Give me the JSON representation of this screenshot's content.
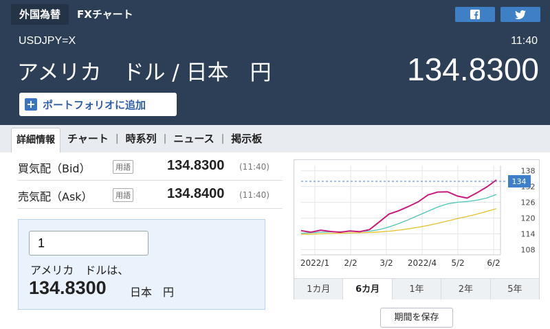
{
  "nav": {
    "tabs": [
      {
        "label": "外国為替"
      },
      {
        "label": "FXチャート"
      }
    ],
    "social": [
      "facebook-icon",
      "twitter-icon"
    ]
  },
  "quote": {
    "symbol": "USDJPY=X",
    "time": "11:40",
    "pair_name": "アメリカ　ドル / 日本　円",
    "price": "134.8300",
    "portfolio_button": "ポートフォリオに追加"
  },
  "subtabs": [
    "詳細情報",
    "チャート",
    "時系列",
    "ニュース",
    "掲示板"
  ],
  "separator": "|",
  "rows": [
    {
      "label": "買気配（Bid）",
      "tag": "用語",
      "value": "134.8300",
      "time": "(11:40)"
    },
    {
      "label": "売気配（Ask）",
      "tag": "用語",
      "value": "134.8400",
      "time": "(11:40)"
    }
  ],
  "converter": {
    "input_value": "1",
    "from_text": "アメリカ　ドルは、",
    "result": "134.8300",
    "to_currency": "日本　円"
  },
  "chart_data": {
    "type": "line",
    "x_labels": [
      "2022/1",
      "2/2",
      "3/2",
      "2022/4",
      "5/2",
      "6/2"
    ],
    "y_ticks": [
      108,
      114,
      120,
      126,
      132,
      138
    ],
    "ylim": [
      106,
      140
    ],
    "current_label": "134",
    "series": [
      {
        "values": [
          115.2,
          114.6,
          115.4,
          114.9,
          114.6,
          115.1,
          114.8,
          115.6,
          118.5,
          121.5,
          122.8,
          124.4,
          126.2,
          128.8,
          129.9,
          130.0,
          128.4,
          127.6,
          129.6,
          131.8,
          134.5
        ],
        "color": "#cc1a7a"
      },
      {
        "values": [
          114.2,
          114.4,
          114.6,
          114.7,
          114.8,
          114.9,
          114.9,
          115.0,
          115.6,
          116.6,
          117.9,
          119.4,
          121.0,
          122.6,
          124.2,
          125.4,
          126.0,
          126.3,
          126.8,
          127.6,
          129.0
        ],
        "color": "#4cc7b5"
      },
      {
        "values": [
          113.8,
          113.9,
          114.0,
          114.1,
          114.2,
          114.3,
          114.4,
          114.5,
          114.7,
          115.0,
          115.4,
          115.9,
          116.5,
          117.2,
          118.0,
          118.9,
          119.8,
          120.6,
          121.5,
          122.5,
          123.6
        ],
        "color": "#e6c22a"
      }
    ]
  },
  "periods": [
    {
      "label": "1カ月",
      "active": false
    },
    {
      "label": "6カ月",
      "active": true
    },
    {
      "label": "1年",
      "active": false
    },
    {
      "label": "2年",
      "active": false
    },
    {
      "label": "5年",
      "active": false
    }
  ],
  "save_button": "期間を保存"
}
